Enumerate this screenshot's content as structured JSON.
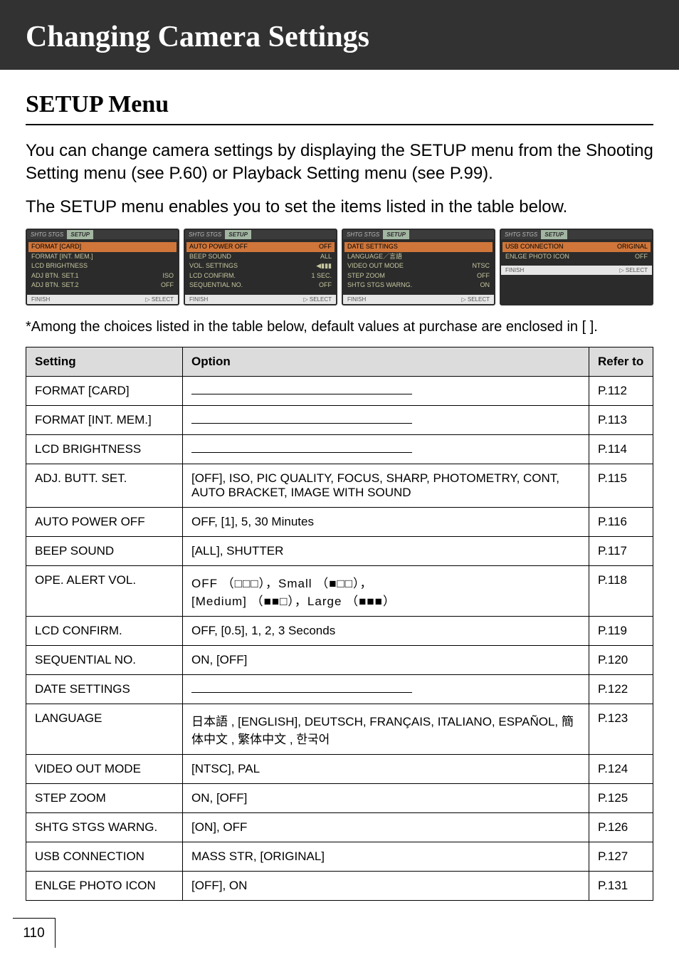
{
  "masthead": "Changing Camera Settings",
  "section_title": "SETUP Menu",
  "para1": "You can change camera settings by displaying the SETUP menu from the Shooting Setting menu (see P.60) or Playback Setting menu (see P.99).",
  "para2": "The SETUP menu enables you to set the items listed in the table below.",
  "shots": [
    {
      "tabs": [
        "SHTG STGS",
        "SETUP"
      ],
      "rows": [
        {
          "l": "FORMAT [CARD]",
          "r": "",
          "hi": true
        },
        {
          "l": "FORMAT [INT. MEM.]",
          "r": ""
        },
        {
          "l": "LCD BRIGHTNESS",
          "r": ""
        },
        {
          "l": "ADJ BTN. SET.1",
          "r": "ISO"
        },
        {
          "l": "ADJ BTN. SET.2",
          "r": "OFF"
        }
      ],
      "foot_left": "FINISH",
      "foot_right": "SELECT"
    },
    {
      "tabs": [
        "SHTG STGS",
        "SETUP"
      ],
      "rows": [
        {
          "l": "AUTO POWER OFF",
          "r": "OFF",
          "hi": true
        },
        {
          "l": "BEEP SOUND",
          "r": "ALL"
        },
        {
          "l": "VOL. SETTINGS",
          "r": "◀▮▮▮"
        },
        {
          "l": "LCD CONFIRM.",
          "r": "1 SEC."
        },
        {
          "l": "SEQUENTIAL NO.",
          "r": "OFF"
        }
      ],
      "foot_left": "FINISH",
      "foot_right": "SELECT"
    },
    {
      "tabs": [
        "SHTG STGS",
        "SETUP"
      ],
      "rows": [
        {
          "l": "DATE SETTINGS",
          "r": "",
          "hi": true
        },
        {
          "l": "LANGUAGE／言語",
          "r": ""
        },
        {
          "l": "VIDEO OUT MODE",
          "r": "NTSC"
        },
        {
          "l": "STEP ZOOM",
          "r": "OFF"
        },
        {
          "l": "SHTG STGS WARNG.",
          "r": "ON"
        }
      ],
      "foot_left": "FINISH",
      "foot_right": "SELECT"
    },
    {
      "tabs": [
        "SHTG STGS",
        "SETUP"
      ],
      "rows": [
        {
          "l": "USB CONNECTION",
          "r": "ORIGINAL",
          "hi": true
        },
        {
          "l": "ENLGE PHOTO ICON",
          "r": "OFF"
        },
        {
          "l": "",
          "r": ""
        },
        {
          "l": "",
          "r": ""
        },
        {
          "l": "",
          "r": ""
        }
      ],
      "foot_left": "FINISH",
      "foot_right": "SELECT"
    }
  ],
  "note": "*Among the choices listed in the table below, default values at purchase are enclosed in [ ].",
  "table": {
    "headers": [
      "Setting",
      "Option",
      "Refer to"
    ],
    "rows": [
      {
        "setting": "FORMAT [CARD]",
        "option_blank": true,
        "refer": "P.112"
      },
      {
        "setting": "FORMAT [INT. MEM.]",
        "option_blank": true,
        "refer": "P.113"
      },
      {
        "setting": "LCD BRIGHTNESS",
        "option_blank": true,
        "refer": "P.114"
      },
      {
        "setting": "ADJ. BUTT. SET.",
        "option": "[OFF], ISO, PIC QUALITY, FOCUS, SHARP, PHOTOMETRY, CONT, AUTO BRACKET, IMAGE WITH SOUND",
        "refer": "P.115"
      },
      {
        "setting": "AUTO POWER OFF",
        "option": "OFF, [1], 5, 30 Minutes",
        "refer": "P.116"
      },
      {
        "setting": "BEEP SOUND",
        "option": "[ALL], SHUTTER",
        "refer": "P.117"
      },
      {
        "setting": "OPE. ALERT VOL.",
        "option_boxes": true,
        "refer": "P.118"
      },
      {
        "setting": "LCD CONFIRM.",
        "option": "OFF, [0.5], 1, 2, 3 Seconds",
        "refer": "P.119"
      },
      {
        "setting": "SEQUENTIAL NO.",
        "option": "ON, [OFF]",
        "refer": "P.120"
      },
      {
        "setting": "DATE SETTINGS",
        "option_blank": true,
        "refer": "P.122"
      },
      {
        "setting": "LANGUAGE",
        "option": "日本語 , [ENGLISH], DEUTSCH, FRANÇAIS, ITALIANO, ESPAÑOL, 簡体中文 , 繁体中文 , 한국어",
        "refer": "P.123"
      },
      {
        "setting": "VIDEO OUT MODE",
        "option": "[NTSC], PAL",
        "refer": "P.124"
      },
      {
        "setting": "STEP ZOOM",
        "option": "ON, [OFF]",
        "refer": "P.125"
      },
      {
        "setting": "SHTG STGS WARNG.",
        "option": "[ON], OFF",
        "refer": "P.126"
      },
      {
        "setting": "USB CONNECTION",
        "option": "MASS STR, [ORIGINAL]",
        "refer": "P.127"
      },
      {
        "setting": "ENLGE PHOTO ICON",
        "option": "[OFF], ON",
        "refer": "P.131"
      }
    ],
    "ope_boxes": {
      "off_label": "OFF",
      "small_label": "Small",
      "medium_label": "[Medium]",
      "large_label": "Large",
      "off_glyph": "（□□□）",
      "small_glyph": "（■□□）",
      "medium_glyph": "（■■□）",
      "large_glyph": "（■■■）"
    }
  },
  "page_number": "110"
}
